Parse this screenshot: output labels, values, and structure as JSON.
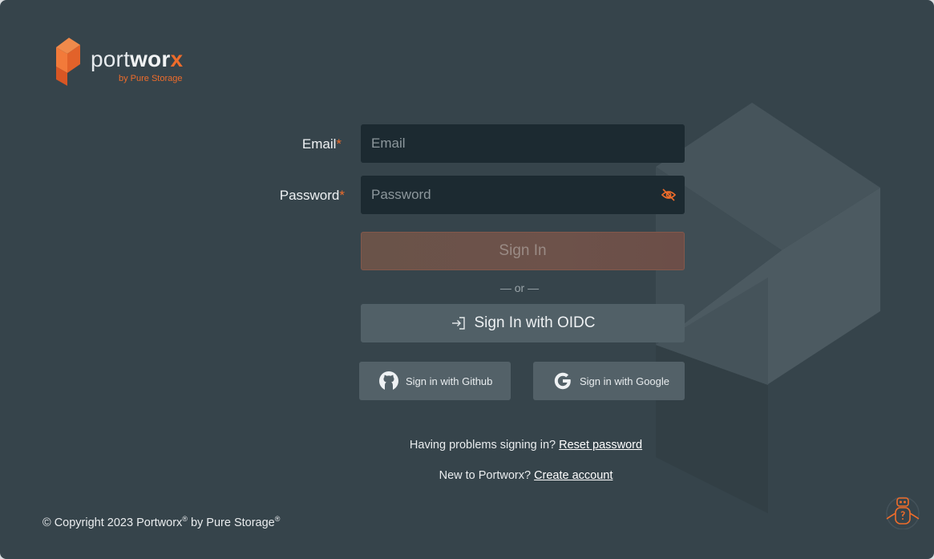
{
  "brand": {
    "name_light": "port",
    "name_bold": "wor",
    "name_x": "x",
    "tagline": "by Pure Storage"
  },
  "form": {
    "email_label": "Email",
    "password_label": "Password",
    "required_mark": "*",
    "email_placeholder": "Email",
    "password_placeholder": "Password",
    "signin_label": "Sign In",
    "or_label": "— or —",
    "oidc_label": "Sign In with OIDC",
    "github_label": "Sign in with Github",
    "google_label": "Sign in with Google"
  },
  "help": {
    "problems_text": "Having problems signing in?",
    "reset_link": "Reset password",
    "new_text": "New to Portworx?",
    "create_link": "Create account"
  },
  "footer": {
    "copyright_prefix": "© Copyright 2023 Portworx",
    "reg1": "®",
    "by_text": " by Pure Storage",
    "reg2": "®"
  },
  "colors": {
    "background": "#36444b",
    "accent": "#ee6c2b",
    "input_bg": "#1c2a31",
    "secondary_button": "#516067"
  },
  "icons": {
    "eye": "eye-slash-icon",
    "oidc": "sign-in-arrow-icon",
    "github": "github-icon",
    "google": "google-icon"
  }
}
